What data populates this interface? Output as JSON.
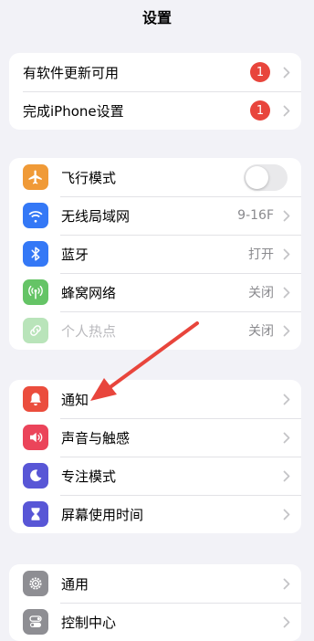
{
  "header": {
    "title": "设置"
  },
  "group_updates": [
    {
      "label": "有软件更新可用",
      "badge": "1"
    },
    {
      "label": "完成iPhone设置",
      "badge": "1"
    }
  ],
  "group_connectivity": [
    {
      "label": "飞行模式",
      "icon": "airplane-icon",
      "color": "#f09a37",
      "toggle": false
    },
    {
      "label": "无线局域网",
      "icon": "wifi-icon",
      "color": "#3478f6",
      "value": "9-16F"
    },
    {
      "label": "蓝牙",
      "icon": "bluetooth-icon",
      "color": "#3478f6",
      "value": "打开"
    },
    {
      "label": "蜂窝网络",
      "icon": "cellular-icon",
      "color": "#65c466",
      "value": "关闭"
    },
    {
      "label": "个人热点",
      "icon": "hotspot-icon",
      "color": "#65c466",
      "value": "关闭",
      "disabled": true
    }
  ],
  "group_notifications": [
    {
      "label": "通知",
      "icon": "bell-icon",
      "color": "#eb4d3d"
    },
    {
      "label": "声音与触感",
      "icon": "speaker-icon",
      "color": "#eb445a"
    },
    {
      "label": "专注模式",
      "icon": "moon-icon",
      "color": "#5856d6"
    },
    {
      "label": "屏幕使用时间",
      "icon": "hourglass-icon",
      "color": "#5856d6"
    }
  ],
  "group_general": [
    {
      "label": "通用",
      "icon": "gear-icon",
      "color": "#8e8e93"
    },
    {
      "label": "控制中心",
      "icon": "toggles-icon",
      "color": "#8e8e93"
    }
  ],
  "colors": {
    "accent_arrow": "#e8453c",
    "badge": "#e8453c"
  }
}
